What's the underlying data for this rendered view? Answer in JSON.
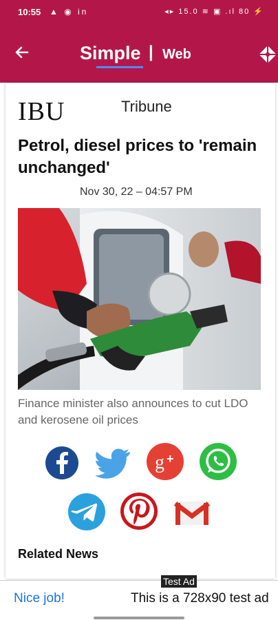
{
  "status_bar": {
    "time": "10:55",
    "left_icons": "▲ ◉ in",
    "right_icons": "◂▸ 15.0 ≋ ▣ .ıl 80 ⚡"
  },
  "app_bar": {
    "brand": "Simple",
    "separator": "|",
    "subtitle": "Web",
    "accent": "#b3174a",
    "underline_color": "#4a8df6"
  },
  "article": {
    "source_logo": "IBU",
    "source_name": "Tribune",
    "headline": "Petrol, diesel prices to 'remain unchanged'",
    "dateline": "Nov 30, 22 – 04:57 PM",
    "caption": "Finance minister also announces to cut LDO and kerosene oil prices"
  },
  "share_icons": [
    "facebook-icon",
    "twitter-icon",
    "google-plus-icon",
    "whatsapp-icon",
    "telegram-icon",
    "pinterest-icon",
    "gmail-icon"
  ],
  "related": {
    "title": "Related News"
  },
  "ad": {
    "tag": "Test Ad",
    "cta": "Nice job!",
    "text": "This is a 728x90 test ad"
  }
}
